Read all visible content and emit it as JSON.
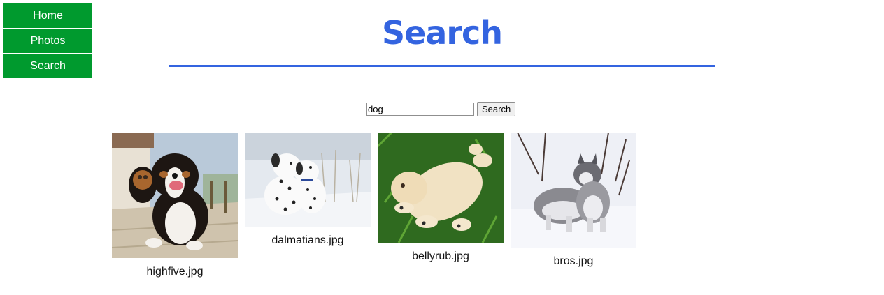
{
  "nav": {
    "items": [
      {
        "label": "Home"
      },
      {
        "label": "Photos"
      },
      {
        "label": "Search"
      }
    ]
  },
  "page": {
    "title": "Search"
  },
  "search": {
    "value": "dog",
    "button_label": "Search"
  },
  "results": [
    {
      "filename": "highfive.jpg"
    },
    {
      "filename": "dalmatians.jpg"
    },
    {
      "filename": "bellyrub.jpg"
    },
    {
      "filename": "bros.jpg"
    }
  ],
  "colors": {
    "nav_bg": "#009a2e",
    "accent": "#3464e0"
  }
}
